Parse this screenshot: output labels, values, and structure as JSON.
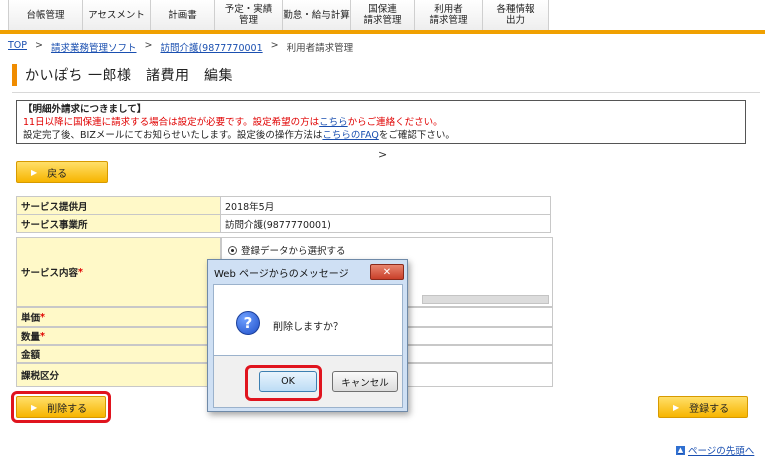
{
  "nav": {
    "tabs": [
      {
        "label": "台帳管理",
        "w": 75
      },
      {
        "label": "アセスメント",
        "w": 68
      },
      {
        "label": "計画書",
        "w": 64
      },
      {
        "label": "予定・実績\n管理",
        "w": 68
      },
      {
        "label": "勤怠・給与計算",
        "w": 68
      },
      {
        "label": "国保連\n請求管理",
        "w": 64
      },
      {
        "label": "利用者\n請求管理",
        "w": 68
      },
      {
        "label": "各種情報\n出力",
        "w": 66
      }
    ]
  },
  "breadcrumb": {
    "top": "TOP",
    "sep": ">",
    "soft": "請求業務管理ソフト",
    "office": "訪問介護(9877770001",
    "current": "利用者請求管理"
  },
  "page_title": "かいぽち 一郎様　諸費用　編集",
  "notice": {
    "head": "【明細外請求につきまして】",
    "line1_pre": "11日以降に国保連に請求する場合は設定が必要です。設定希望の方は",
    "line1_link": "こちら",
    "line1_post": "からご連絡ください。",
    "line2_pre": "設定完了後、BIZメールにてお知らせいたします。設定後の操作方法は",
    "line2_link": "こちらのFAQ",
    "line2_post": "をご確認下さい。"
  },
  "chevron": ">",
  "buttons": {
    "back": "戻る",
    "delete": "削除する",
    "register": "登録する",
    "arrow": "▶"
  },
  "info": {
    "month_label": "サービス提供月",
    "month_value": "2018年5月",
    "office_label": "サービス事業所",
    "office_value": "訪問介護(9877770001)"
  },
  "service": {
    "content_label": "サービス内容",
    "radio_label": "登録データから選択する",
    "price_label": "単価",
    "qty_label": "数量",
    "amount_label": "金額",
    "tax_label": "課税区分",
    "required": "*"
  },
  "dialog": {
    "title": "Web ページからのメッセージ",
    "close": "✕",
    "message": "削除しますか？",
    "icon": "?",
    "ok": "OK",
    "cancel": "キャンセル"
  },
  "pagetop": {
    "icon": "▲",
    "label": "ページの先頭へ"
  }
}
